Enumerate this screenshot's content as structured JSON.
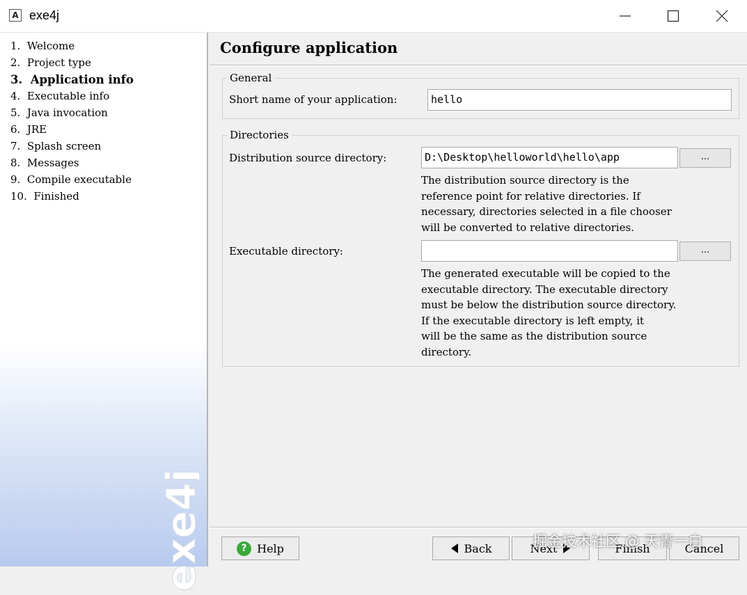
{
  "window": {
    "title": "exe4j",
    "app_icon_glyph": "A",
    "min_glyph": "—",
    "max_glyph": "☐",
    "close_glyph": "✕"
  },
  "sidebar": {
    "steps": [
      {
        "label": "1.  Welcome"
      },
      {
        "label": "2.  Project type"
      },
      {
        "label": "3.  Application info",
        "active": true
      },
      {
        "label": "4.  Executable info"
      },
      {
        "label": "5.  Java invocation"
      },
      {
        "label": "6.  JRE"
      },
      {
        "label": "7.  Splash screen"
      },
      {
        "label": "8.  Messages"
      },
      {
        "label": "9.  Compile executable"
      },
      {
        "label": "10.  Finished"
      }
    ],
    "brand_logo_text": "exe4j"
  },
  "main": {
    "page_title": "Configure application",
    "general": {
      "legend": "General",
      "short_name_label": "Short name of your application:",
      "short_name_value": "hello"
    },
    "directories": {
      "legend": "Directories",
      "dist_label": "Distribution source directory:",
      "dist_value": "D:\\Desktop\\helloworld\\hello\\app",
      "dist_browse": "...",
      "dist_help": "The distribution source directory is the\nreference point for relative directories. If\nnecessary, directories selected in a file chooser\nwill be converted to relative directories.",
      "exec_label": "Executable directory:",
      "exec_value": "",
      "exec_browse": "...",
      "exec_help": "The generated executable will be copied to the\nexecutable directory. The executable directory\nmust be below the distribution source directory.\nIf the executable directory is left empty, it\nwill be the same as the distribution source\ndirectory."
    }
  },
  "buttons": {
    "help": "Help",
    "back": "Back",
    "next": "Next",
    "finish": "Finish",
    "cancel": "Cancel"
  },
  "watermark": "掘金技术社区 @ 天青一白",
  "colors": {
    "sidebar_gradient_end": "#b8cbee",
    "help_icon": "#3aa83a"
  }
}
